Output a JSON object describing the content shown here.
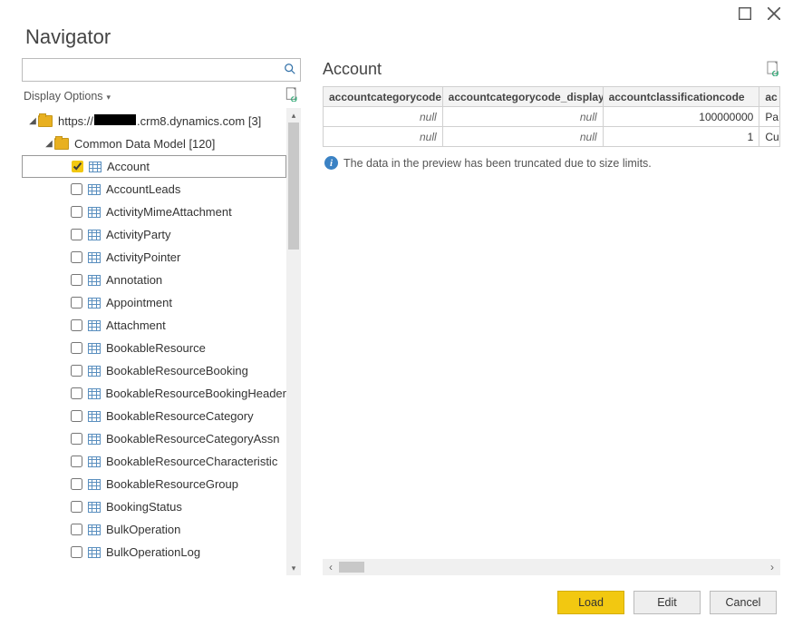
{
  "window": {
    "title": "Navigator"
  },
  "search": {
    "value": "",
    "placeholder": ""
  },
  "display_options_label": "Display Options",
  "tree": {
    "root": {
      "label_prefix": "https://",
      "label_suffix": ".crm8.dynamics.com [3]"
    },
    "group": {
      "label": "Common Data Model [120]"
    },
    "items": [
      {
        "label": "Account",
        "checked": true,
        "selected": true
      },
      {
        "label": "AccountLeads"
      },
      {
        "label": "ActivityMimeAttachment"
      },
      {
        "label": "ActivityParty"
      },
      {
        "label": "ActivityPointer"
      },
      {
        "label": "Annotation"
      },
      {
        "label": "Appointment"
      },
      {
        "label": "Attachment"
      },
      {
        "label": "BookableResource"
      },
      {
        "label": "BookableResourceBooking"
      },
      {
        "label": "BookableResourceBookingHeader"
      },
      {
        "label": "BookableResourceCategory"
      },
      {
        "label": "BookableResourceCategoryAssn"
      },
      {
        "label": "BookableResourceCharacteristic"
      },
      {
        "label": "BookableResourceGroup"
      },
      {
        "label": "BookingStatus"
      },
      {
        "label": "BulkOperation"
      },
      {
        "label": "BulkOperationLog"
      }
    ]
  },
  "preview": {
    "title": "Account",
    "columns": [
      "accountcategorycode",
      "accountcategorycode_display",
      "accountclassificationcode",
      "ac"
    ],
    "rows": [
      {
        "c0": "null",
        "c1": "null",
        "c2": "100000000",
        "c3": "Pa"
      },
      {
        "c0": "null",
        "c1": "null",
        "c2": "1",
        "c3": "Cu"
      }
    ],
    "info": "The data in the preview has been truncated due to size limits."
  },
  "buttons": {
    "load": "Load",
    "edit": "Edit",
    "cancel": "Cancel"
  }
}
